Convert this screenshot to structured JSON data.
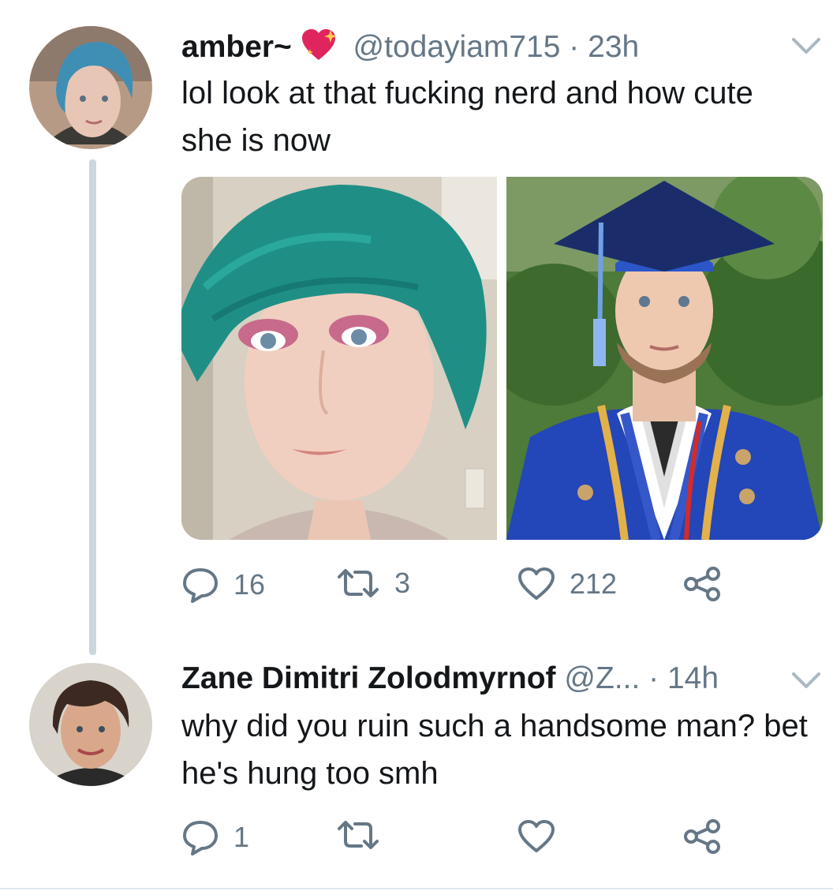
{
  "tweet1": {
    "name": "amber~",
    "handle": "@todayiam715",
    "time": "23h",
    "text": "lol look at that fucking nerd and how cute she is now",
    "replies": "16",
    "retweets": "3",
    "likes": "212",
    "name_emoji": "sparkling-heart-icon"
  },
  "tweet2": {
    "name": "Zane Dimitri Zolodmyrnof",
    "handle": "@Z...",
    "time": "14h",
    "text": "why did you ruin such a handsome man? bet he's hung too smh",
    "replies": "1",
    "retweets": "",
    "likes": ""
  },
  "colors": {
    "muted": "#657786",
    "line": "#ccd6dd",
    "heart": "#e0245e"
  }
}
